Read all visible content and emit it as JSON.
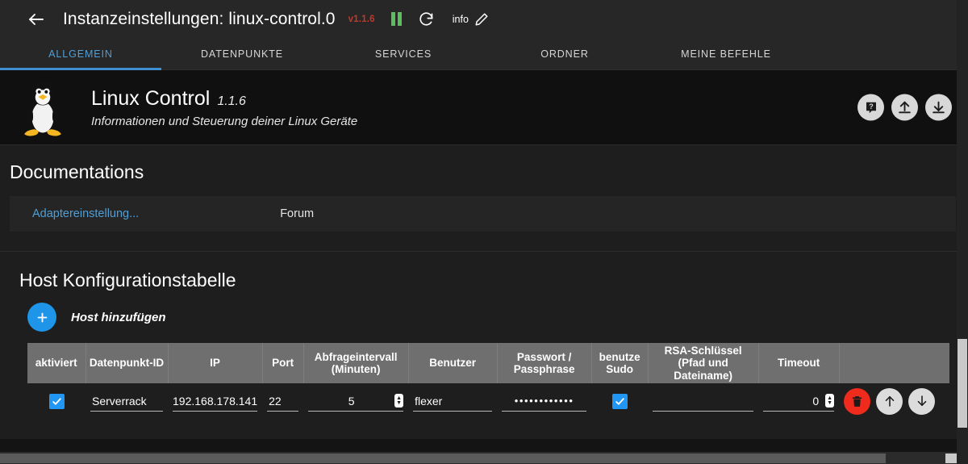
{
  "titlebar": {
    "back_icon": "arrow-left-icon",
    "title": "Instanzeinstellungen: linux-control.0",
    "version_badge": "v1.1.6",
    "pause_icon": "pause-icon",
    "refresh_icon": "refresh-icon",
    "info_label": "info",
    "edit_icon": "pencil-icon"
  },
  "tabs": [
    {
      "label": "ALLGEMEIN",
      "active": true
    },
    {
      "label": "DATENPUNKTE",
      "active": false
    },
    {
      "label": "SERVICES",
      "active": false
    },
    {
      "label": "ORDNER",
      "active": false
    },
    {
      "label": "MEINE BEFEHLE",
      "active": false
    }
  ],
  "adapter": {
    "logo_icon": "tux-penguin-logo",
    "name": "Linux Control",
    "version": "1.1.6",
    "description": "Informationen und Steuerung deiner Linux Geräte",
    "actions": [
      {
        "name": "help-button",
        "icon": "question-mark-icon"
      },
      {
        "name": "upload-button",
        "icon": "upload-arrow-icon"
      },
      {
        "name": "download-button",
        "icon": "download-arrow-icon"
      }
    ]
  },
  "documentation": {
    "heading": "Documentations",
    "links": [
      {
        "label": "Adaptereinstellung...",
        "active": true
      },
      {
        "label": "Forum",
        "active": false
      }
    ]
  },
  "host_table": {
    "heading": "Host Konfigurationstabelle",
    "add_button_icon": "plus-icon",
    "add_label": "Host hinzufügen",
    "columns": [
      "aktiviert",
      "Datenpunkt-ID",
      "IP",
      "Port",
      "Abfrageintervall (Minuten)",
      "Benutzer",
      "Passwort / Passphrase",
      "benutze Sudo",
      "RSA-Schlüssel (Pfad und Dateiname)",
      "Timeout",
      ""
    ],
    "rows": [
      {
        "aktiviert": true,
        "datenpunkt_id": "Serverrack",
        "ip": "192.168.178.141",
        "port": "22",
        "abfrageintervall": "5",
        "benutzer": "flexer",
        "passwort": "••••••••••••",
        "benutze_sudo": true,
        "rsa_key": "",
        "timeout": "0",
        "delete_icon": "trash-icon",
        "move_up_icon": "arrow-up-icon",
        "move_down_icon": "arrow-down-icon"
      }
    ]
  },
  "colors": {
    "accent_blue": "#2196f3",
    "tab_blue": "#4f9fd8",
    "version_red": "#c0392b",
    "pause_green": "#5cbd5c",
    "delete_red": "#ee2b1c",
    "header_gray": "#6f6f6f",
    "background": "#1e1e1e"
  }
}
